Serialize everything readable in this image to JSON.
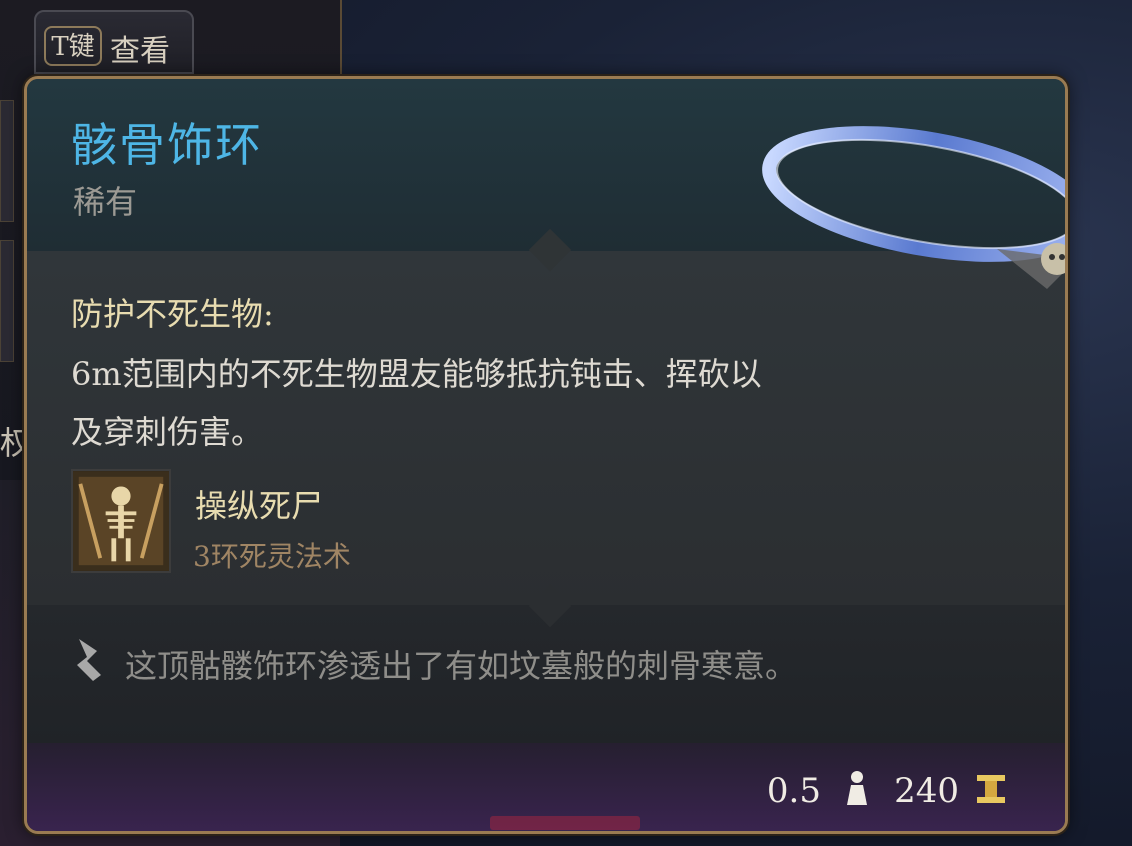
{
  "hint": {
    "key": "T键",
    "label": "查看"
  },
  "edge_char": "权",
  "item": {
    "name": "骸骨饰环",
    "rarity": "稀有",
    "name_color": "#4eb6e6"
  },
  "effect": {
    "title": "防护不死生物:",
    "description": "6m范围内的不死生物盟友能够抵抗钝击、挥砍以及穿刺伤害。"
  },
  "spell": {
    "name": "操纵死尸",
    "subtitle": "3环死灵法术",
    "icon": "skeleton-icon"
  },
  "flavor": {
    "icon": "quill-icon",
    "text": "这顶骷髅饰环渗透出了有如坟墓般的刺骨寒意。"
  },
  "footer": {
    "weight": "0.5",
    "weight_icon": "weight-icon",
    "price": "240",
    "price_icon": "gold-coin-icon"
  }
}
